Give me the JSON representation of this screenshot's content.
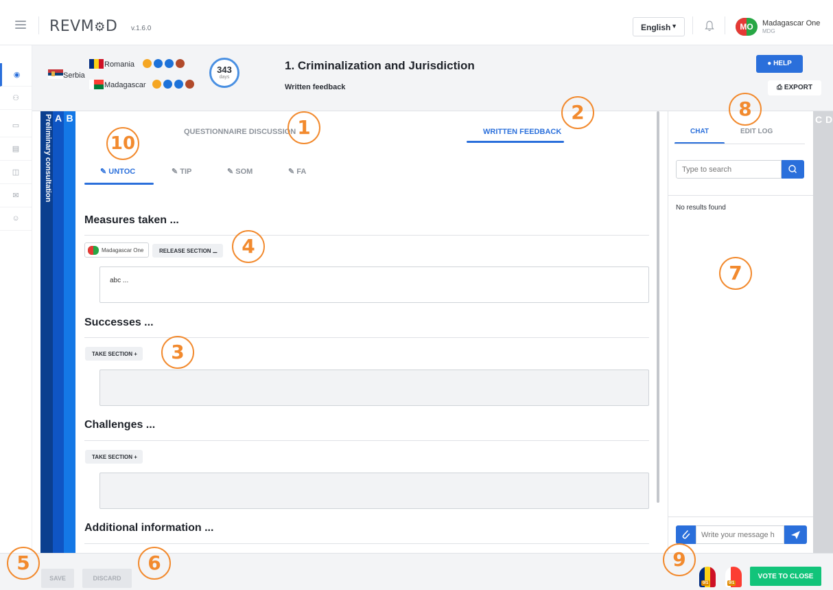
{
  "topbar": {
    "logo": "REVM",
    "logo_suffix": "D",
    "version": "v.1.6.0",
    "language": "English",
    "user_initials": "MO",
    "user_name": "Madagascar One",
    "user_code": "MDG"
  },
  "header": {
    "countries": [
      {
        "name": "Serbia"
      },
      {
        "name": "Romania"
      },
      {
        "name": "Madagascar"
      }
    ],
    "days_count": "343",
    "days_unit": "days",
    "title": "1. Criminalization and Jurisdiction",
    "subtitle": "Written feedback",
    "help_label": "HELP",
    "export_label": "EXPORT"
  },
  "side_bars": {
    "vertical_label": "Preliminary consultation",
    "a": "A",
    "b": "B",
    "c": "C",
    "d": "D"
  },
  "main": {
    "tab_questionnaire": "QUESTIONNAIRE DISCUSSION",
    "tab_written": "WRITTEN FEEDBACK",
    "subtabs": [
      "UNTOC",
      "TIP",
      "SOM",
      "FA"
    ],
    "sections": [
      {
        "title": "Measures taken ...",
        "owner": "Madagascar One",
        "action": "RELEASE SECTION",
        "value": "abc ..."
      },
      {
        "title": "Successes ...",
        "action": "TAKE SECTION",
        "value": ""
      },
      {
        "title": "Challenges ...",
        "action": "TAKE SECTION",
        "value": ""
      },
      {
        "title": "Additional information ..."
      }
    ]
  },
  "chat": {
    "tab_chat": "CHAT",
    "tab_editlog": "EDIT LOG",
    "search_placeholder": "Type to search",
    "no_results": "No results found",
    "message_placeholder": "Write your message h"
  },
  "footer": {
    "save_label": "SAVE",
    "discard_label": "DISCARD",
    "vote_counts": [
      "0/1",
      "0/1"
    ],
    "vote_label": "VOTE TO CLOSE"
  },
  "markers": [
    "1",
    "2",
    "3",
    "4",
    "5",
    "6",
    "7",
    "8",
    "9",
    "10"
  ],
  "colors": {
    "accent": "#2a6fdb",
    "marker": "#f28a2e",
    "vote": "#12c47a",
    "bar_dark": "#0b3f8f",
    "bar_mid": "#0f55c4",
    "bar_light": "#1478e6"
  }
}
